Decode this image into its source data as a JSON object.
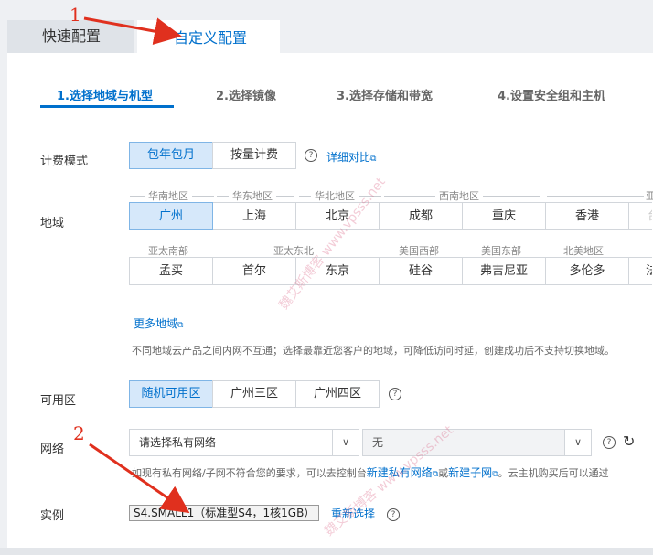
{
  "tabs": {
    "quick": "快速配置",
    "custom": "自定义配置"
  },
  "steps": [
    "1.选择地域与机型",
    "2.选择镜像",
    "3.选择存储和带宽",
    "4.设置安全组和主机"
  ],
  "billing": {
    "label": "计费模式",
    "options": [
      "包年包月",
      "按量计费"
    ],
    "selected": "包年包月",
    "compare_link": "详细对比"
  },
  "region": {
    "label": "地域",
    "groups_row1": [
      "华南地区",
      "华东地区",
      "华北地区",
      "西南地区",
      "亚"
    ],
    "row1": [
      "广州",
      "上海",
      "北京",
      "成都",
      "重庆",
      "香港",
      "台"
    ],
    "groups_row2": [
      "亚太南部",
      "亚太东北",
      "美国西部",
      "美国东部",
      "北美地区"
    ],
    "row2": [
      "孟买",
      "首尔",
      "东京",
      "硅谷",
      "弗吉尼亚",
      "多伦多",
      "法"
    ],
    "selected": "广州",
    "more_link": "更多地域",
    "note": "不同地域云产品之间内网不互通；选择最靠近您客户的地域，可降低访问时延，创建成功后不支持切换地域。"
  },
  "zone": {
    "label": "可用区",
    "options": [
      "随机可用区",
      "广州三区",
      "广州四区"
    ],
    "selected": "随机可用区"
  },
  "network": {
    "label": "网络",
    "vpc_placeholder": "请选择私有网络",
    "subnet_value": "无",
    "note_prefix": "如现有私有网络/子网不符合您的要求，可以去控制台",
    "new_vpc_link": "新建私有网络",
    "or_text": "或",
    "new_subnet_link": "新建子网",
    "note_suffix": "。云主机购买后可以通过"
  },
  "instance": {
    "label": "实例",
    "value": "S4.SMALL1（标准型S4，1核1GB）",
    "reselect_link": "重新选择"
  },
  "annotations": [
    "1",
    "2"
  ],
  "watermark": "魏艾斯博客 www.vpsss.net",
  "colors": {
    "accent": "#0070cc",
    "selected_bg": "#d6e8fa",
    "annotation": "#e0301e"
  }
}
